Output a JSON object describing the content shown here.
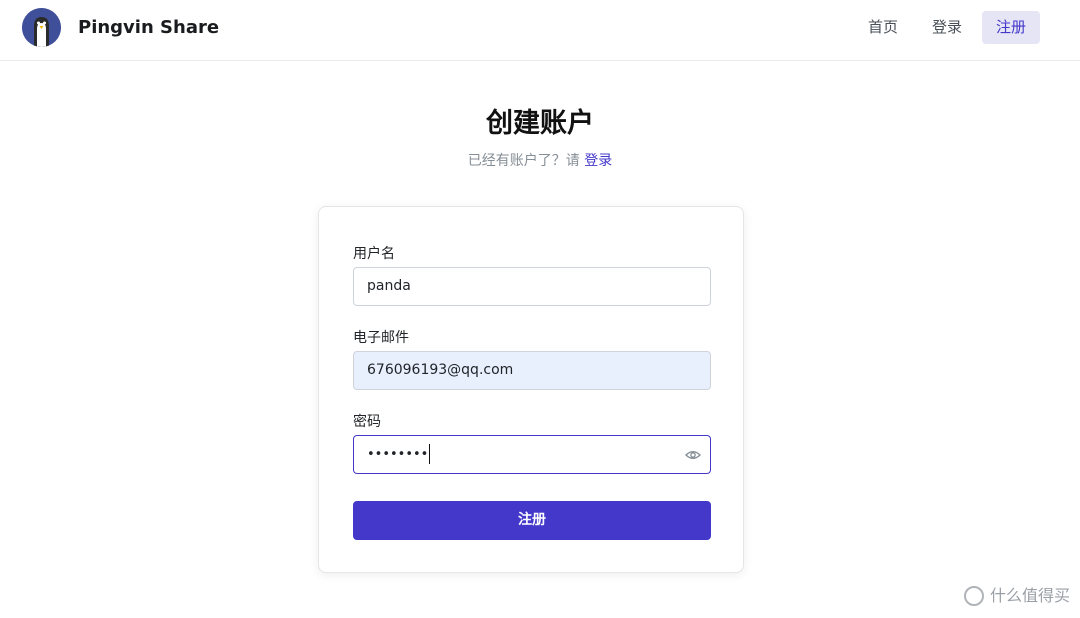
{
  "header": {
    "brand": "Pingvin Share",
    "nav": [
      {
        "label": "首页"
      },
      {
        "label": "登录"
      },
      {
        "label": "注册",
        "active": true
      }
    ]
  },
  "page": {
    "title": "创建账户",
    "subtitle_prefix": "已经有账户了？请",
    "subtitle_link": "登录"
  },
  "form": {
    "username": {
      "label": "用户名",
      "value": "panda"
    },
    "email": {
      "label": "电子邮件",
      "value": "676096193@qq.com"
    },
    "password": {
      "label": "密码",
      "masked_value": "••••••••"
    },
    "submit_label": "注册"
  },
  "watermark": {
    "text": "什么值得买"
  },
  "colors": {
    "accent": "#4338ca",
    "nav_active_bg": "#e5e5f6",
    "autofill_bg": "#e8f0fe"
  },
  "icons": {
    "logo": "penguin-logo-icon",
    "password_toggle": "eye-icon"
  }
}
